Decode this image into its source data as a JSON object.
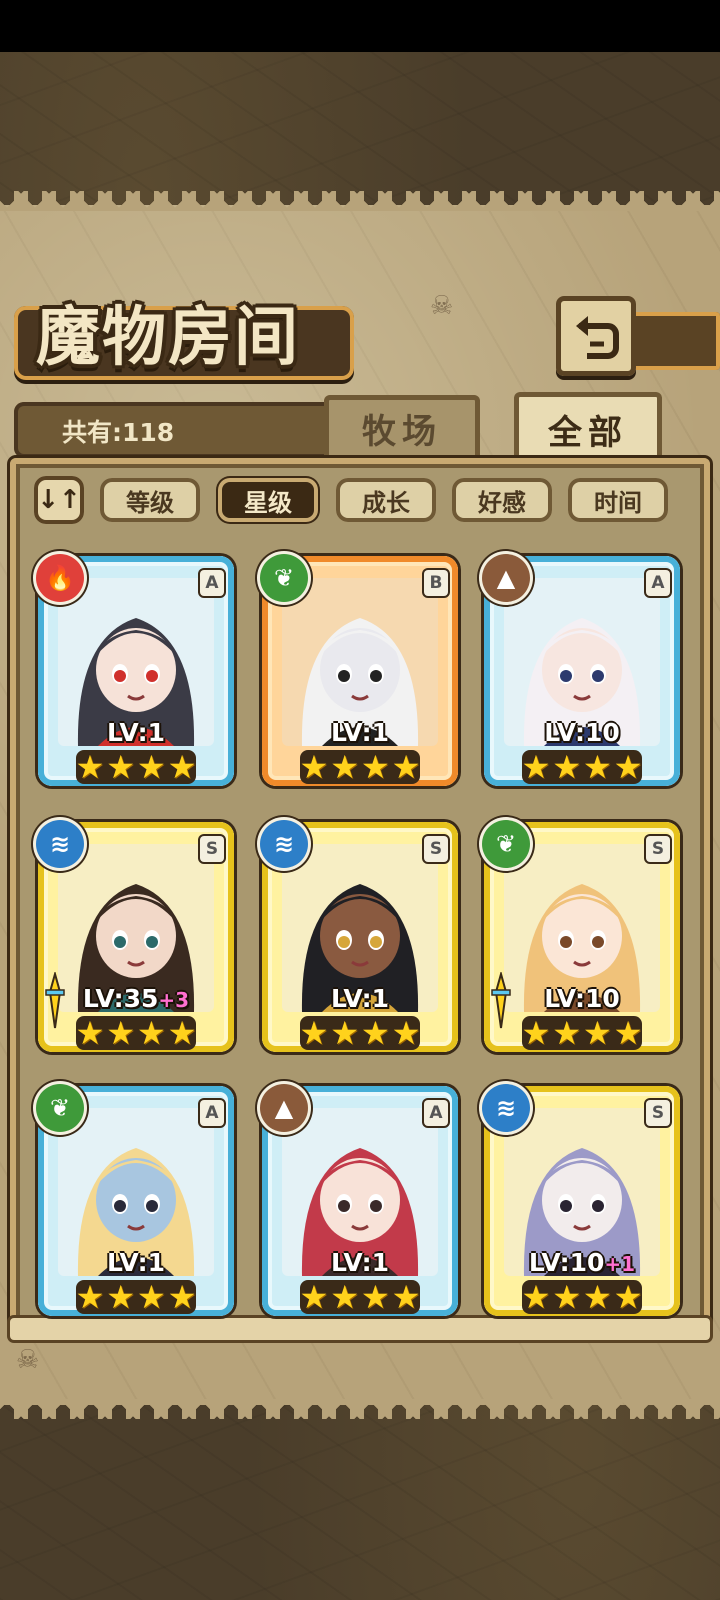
{
  "title": "魔物房间",
  "count_label": "共有:118",
  "top_tabs": [
    {
      "label": "牧场",
      "active": false
    },
    {
      "label": "全部",
      "active": true
    }
  ],
  "sort_icon_label": "↓↑",
  "sort_buttons": [
    {
      "label": "等级",
      "active": false
    },
    {
      "label": "星级",
      "active": true
    },
    {
      "label": "成长",
      "active": false
    },
    {
      "label": "好感",
      "active": false
    },
    {
      "label": "时间",
      "active": false
    }
  ],
  "cards": [
    {
      "rarity": "A",
      "frame": "blue",
      "element": "fire",
      "element_glyph": "🔥",
      "element_color": "#e0403a",
      "level": "LV:1",
      "plus": "",
      "stars": 4,
      "has_sword": false,
      "hair": "#3b3b46",
      "skin": "#f6e2d8",
      "accent": "#d0302c"
    },
    {
      "rarity": "B",
      "frame": "orange",
      "element": "leaf",
      "element_glyph": "❦",
      "element_color": "#3f9a3a",
      "level": "LV:1",
      "plus": "",
      "stars": 4,
      "has_sword": false,
      "hair": "#f2f2f2",
      "skin": "#e9e9ee",
      "accent": "#222222"
    },
    {
      "rarity": "A",
      "frame": "blue",
      "element": "earth",
      "element_glyph": "▲",
      "element_color": "#8a5a3a",
      "level": "LV:10",
      "plus": "",
      "stars": 4,
      "has_sword": false,
      "hair": "#f4f0f4",
      "skin": "#f7e6e0",
      "accent": "#2c3a6e"
    },
    {
      "rarity": "S",
      "frame": "gold",
      "element": "water",
      "element_glyph": "≋",
      "element_color": "#2d7fc8",
      "level": "LV:35",
      "plus": "+3",
      "stars": 4,
      "has_sword": true,
      "hair": "#3a2a20",
      "skin": "#f2d8c8",
      "accent": "#2c6a6a"
    },
    {
      "rarity": "S",
      "frame": "gold",
      "element": "water",
      "element_glyph": "≋",
      "element_color": "#2d7fc8",
      "level": "LV:1",
      "plus": "",
      "stars": 4,
      "has_sword": false,
      "hair": "#202024",
      "skin": "#8a5a40",
      "accent": "#d6a63a"
    },
    {
      "rarity": "S",
      "frame": "gold",
      "element": "leaf",
      "element_glyph": "❦",
      "element_color": "#3f9a3a",
      "level": "LV:10",
      "plus": "",
      "stars": 4,
      "has_sword": true,
      "hair": "#f0c27a",
      "skin": "#fbe6d6",
      "accent": "#7a4a2a"
    },
    {
      "rarity": "A",
      "frame": "blue",
      "element": "leaf",
      "element_glyph": "❦",
      "element_color": "#3f9a3a",
      "level": "LV:1",
      "plus": "",
      "stars": 4,
      "has_sword": false,
      "hair": "#f4d890",
      "skin": "#a8c6e0",
      "accent": "#2a2a3a"
    },
    {
      "rarity": "A",
      "frame": "blue",
      "element": "earth",
      "element_glyph": "▲",
      "element_color": "#8a5a3a",
      "level": "LV:1",
      "plus": "",
      "stars": 4,
      "has_sword": false,
      "hair": "#c23a4a",
      "skin": "#f8e2d8",
      "accent": "#3a2a2a"
    },
    {
      "rarity": "S",
      "frame": "gold",
      "element": "water",
      "element_glyph": "≋",
      "element_color": "#2d7fc8",
      "level": "LV:10",
      "plus": "+1",
      "stars": 4,
      "has_sword": false,
      "hair": "#9c9ac8",
      "skin": "#f2ecec",
      "accent": "#2a2432"
    }
  ]
}
